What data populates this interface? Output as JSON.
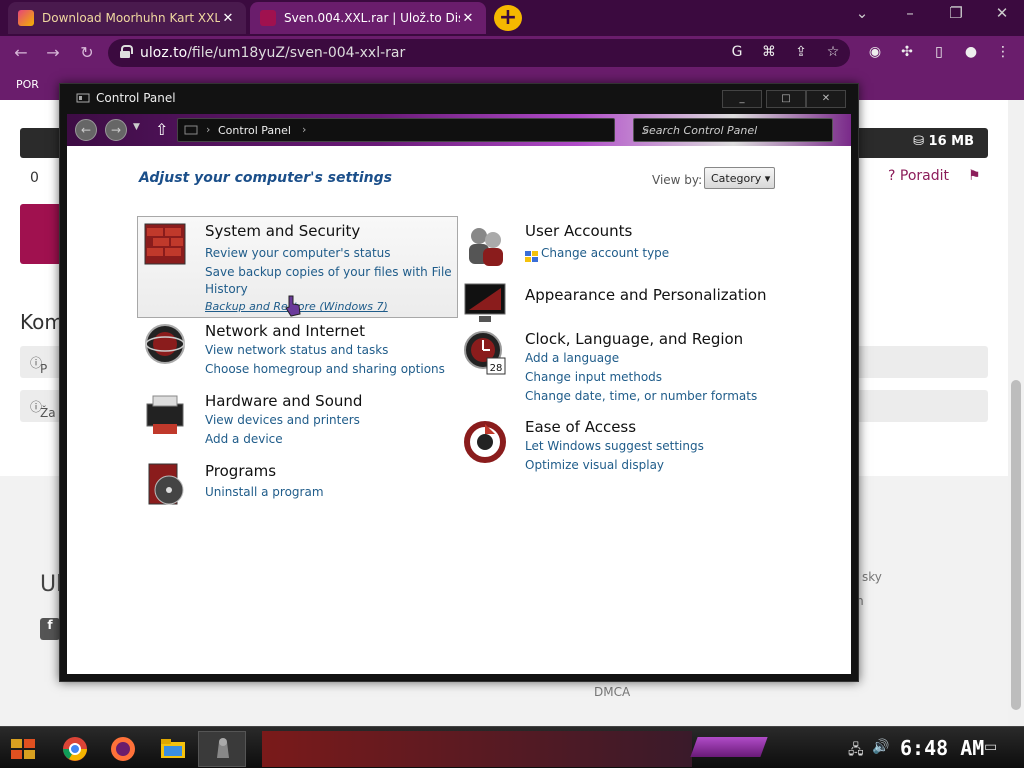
{
  "browser": {
    "tabs": [
      {
        "title": "Download Moorhuhn Kart XXL",
        "active": false
      },
      {
        "title": "Sven.004.XXL.rar | Ulož.to Dis",
        "active": true
      }
    ],
    "url_domain": "uloz.to",
    "url_path": "/file/um18yuZ/sven-004-xxl-rar",
    "bookmark_first": "POR"
  },
  "webpage": {
    "file_size": "16 MB",
    "count": "0",
    "advise": "Poradit",
    "section_partial": "Kom",
    "info_row_1": "P",
    "info_row_2": "Ža",
    "footer_partial_1": "Ul",
    "footer_partial_2": "sky",
    "footer_partial_3": "m",
    "dmca": "DMCA"
  },
  "control_panel": {
    "window_title": "Control Panel",
    "address_crumb": "Control Panel",
    "search_placeholder": "Search Control Panel",
    "heading": "Adjust your computer's settings",
    "view_by_label": "View by:",
    "view_by_value": "Category",
    "categories": [
      {
        "title": "System and Security",
        "links": [
          "Review your computer's status",
          "Save backup copies of your files with File",
          "History",
          "Backup and Restore (Windows 7)"
        ]
      },
      {
        "title": "Network and Internet",
        "links": [
          "View network status and tasks",
          "Choose homegroup and sharing options"
        ]
      },
      {
        "title": "Hardware and Sound",
        "links": [
          "View devices and printers",
          "Add a device"
        ]
      },
      {
        "title": "Programs",
        "links": [
          "Uninstall a program"
        ]
      },
      {
        "title": "User Accounts",
        "links": [
          "Change account type"
        ]
      },
      {
        "title": "Appearance and Personalization",
        "links": []
      },
      {
        "title": "Clock, Language, and Region",
        "links": [
          "Add a language",
          "Change input methods",
          "Change date, time, or number formats"
        ]
      },
      {
        "title": "Ease of Access",
        "links": [
          "Let Windows suggest settings",
          "Optimize visual display"
        ]
      }
    ]
  },
  "taskbar": {
    "clock": "6:48 AM",
    "calendar_day": "28"
  },
  "colors": {
    "browser_frame": "#6a1d6c",
    "tab_strip": "#3b0a3f",
    "new_tab_button": "#f5b800",
    "link_blue": "#1f5c8a",
    "heading_blue": "#1b4f8a"
  }
}
